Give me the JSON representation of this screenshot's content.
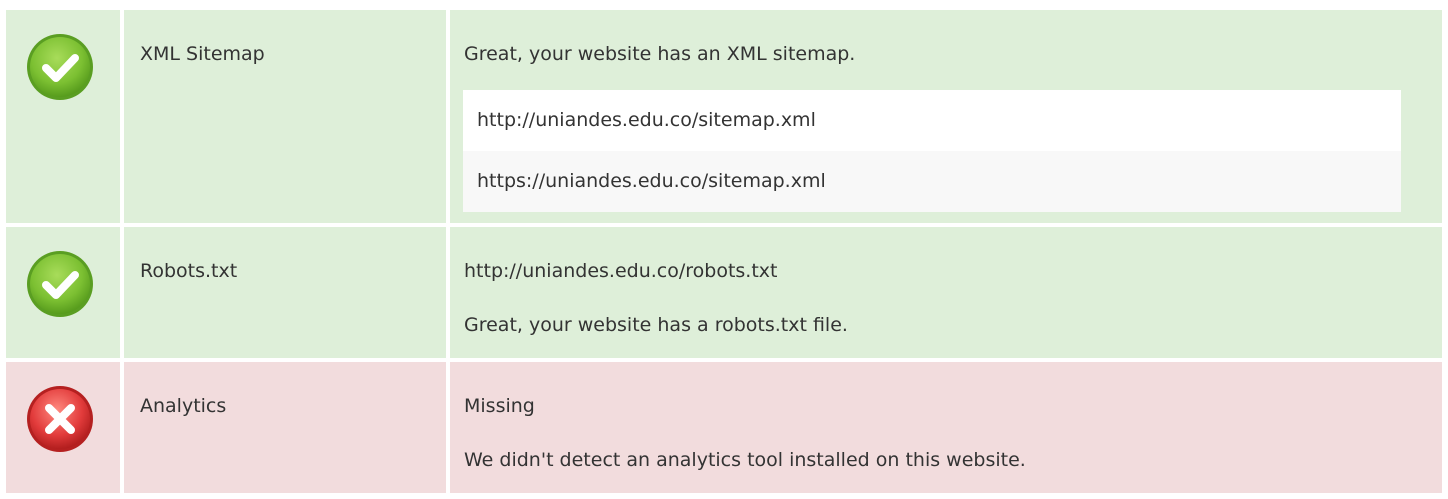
{
  "checks": [
    {
      "status": "pass",
      "icon": "check-circle-icon",
      "label": "XML Sitemap",
      "message": "Great, your website has an XML sitemap.",
      "urls": [
        "http://uniandes.edu.co/sitemap.xml",
        "https://uniandes.edu.co/sitemap.xml"
      ]
    },
    {
      "status": "pass",
      "icon": "check-circle-icon",
      "label": "Robots.txt",
      "url": "http://uniandes.edu.co/robots.txt",
      "message": "Great, your website has a robots.txt file."
    },
    {
      "status": "fail",
      "icon": "x-circle-icon",
      "label": "Analytics",
      "value": "Missing",
      "message": "We didn't detect an analytics tool installed on this website."
    }
  ],
  "colors": {
    "pass_bg": "#deefd9",
    "fail_bg": "#f2dcdd",
    "pass_icon": "#7cc032",
    "fail_icon": "#e23b3b",
    "text": "#333333"
  }
}
